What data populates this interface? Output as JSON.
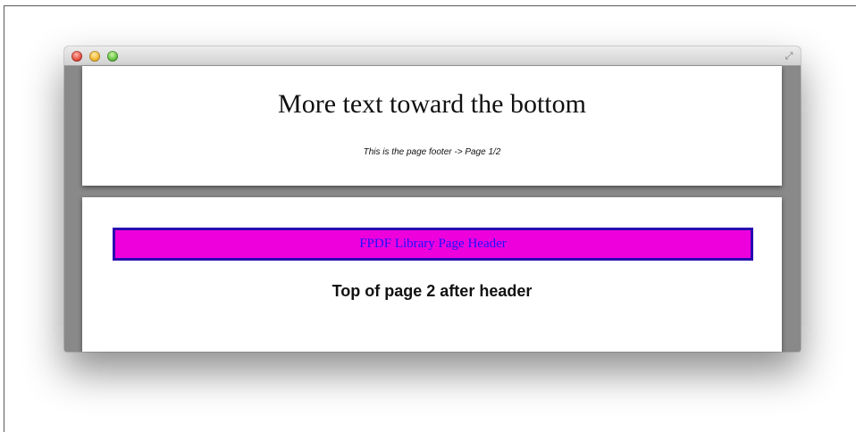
{
  "window": {
    "controls": {
      "close_color": "#e2473a",
      "minimize_color": "#f0b52a",
      "zoom_color": "#5ebb3c",
      "fullscreen_icon": "fullscreen-arrows-icon"
    }
  },
  "document": {
    "page1": {
      "body_text": "More text toward the bottom",
      "footer": "This is the page footer -> Page 1/2"
    },
    "page2": {
      "header": "FPDF Library Page Header",
      "heading": "Top of page 2 after header",
      "header_fill": "#ee00dd",
      "header_border": "#2a0ab0",
      "header_text_color": "#1f10ff"
    }
  }
}
